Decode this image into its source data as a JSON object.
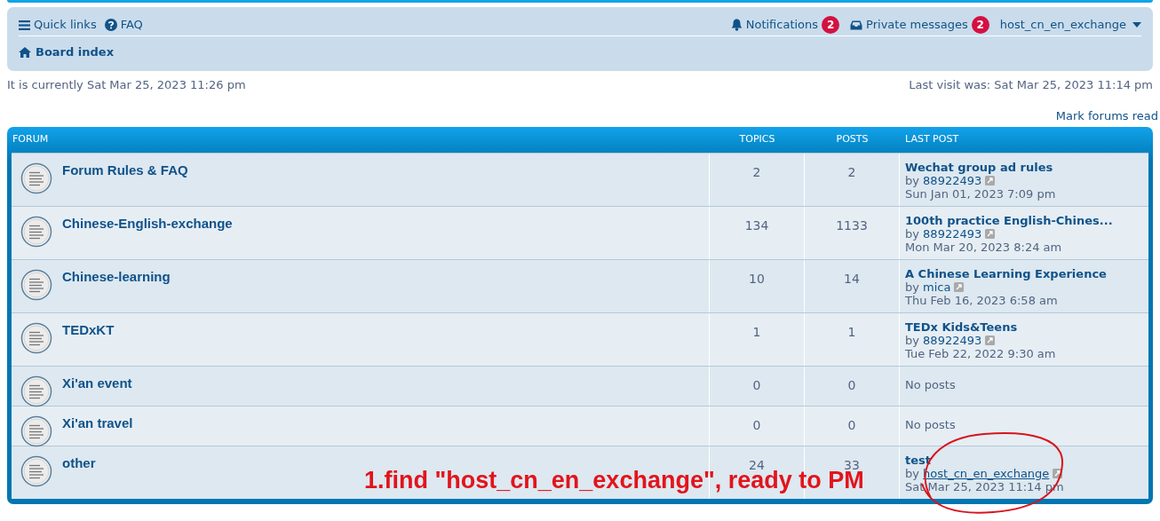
{
  "navbar": {
    "quick_links": "Quick links",
    "faq": "FAQ",
    "notifications": {
      "label": "Notifications",
      "count": "2"
    },
    "private_messages": {
      "label": "Private messages",
      "count": "2"
    },
    "username": "host_cn_en_exchange",
    "breadcrumb": "Board index"
  },
  "current_time": "It is currently Sat Mar 25, 2023 11:26 pm",
  "last_visit": "Last visit was: Sat Mar 25, 2023 11:14 pm",
  "mark_read": "Mark forums read",
  "table": {
    "columns": [
      "FORUM",
      "TOPICS",
      "POSTS",
      "LAST POST"
    ],
    "rows": [
      {
        "name": "Forum Rules & FAQ",
        "topics": "2",
        "posts": "2",
        "last_post": {
          "kind": "post",
          "title": "Wechat group ad rules",
          "by": "by",
          "author": "88922493",
          "hovered": false,
          "time": "Sun Jan 01, 2023 7:09 pm"
        }
      },
      {
        "name": "Chinese-English-exchange",
        "topics": "134",
        "posts": "1133",
        "last_post": {
          "kind": "post",
          "title": "100th practice English-Chines...",
          "by": "by",
          "author": "88922493",
          "hovered": false,
          "time": "Mon Mar 20, 2023 8:24 am"
        }
      },
      {
        "name": "Chinese-learning",
        "topics": "10",
        "posts": "14",
        "last_post": {
          "kind": "post",
          "title": "A Chinese Learning Experience",
          "by": "by",
          "author": "mica",
          "hovered": false,
          "time": "Thu Feb 16, 2023 6:58 am"
        }
      },
      {
        "name": "TEDxKT",
        "topics": "1",
        "posts": "1",
        "last_post": {
          "kind": "post",
          "title": "TEDx Kids&Teens",
          "by": "by",
          "author": "88922493",
          "hovered": false,
          "time": "Tue Feb 22, 2022 9:30 am"
        }
      },
      {
        "name": "Xi'an event",
        "topics": "0",
        "posts": "0",
        "last_post": {
          "kind": "empty",
          "text": "No posts"
        }
      },
      {
        "name": "Xi'an travel",
        "topics": "0",
        "posts": "0",
        "last_post": {
          "kind": "empty",
          "text": "No posts"
        }
      },
      {
        "name": "other",
        "topics": "24",
        "posts": "33",
        "last_post": {
          "kind": "post",
          "title": "test",
          "by": "by",
          "author": "host_cn_en_exchange",
          "hovered": true,
          "time": "Sat Mar 25, 2023 11:14 pm"
        }
      }
    ]
  },
  "annotation": {
    "text": "1.find \"host_cn_en_exchange\", ready to PM"
  }
}
